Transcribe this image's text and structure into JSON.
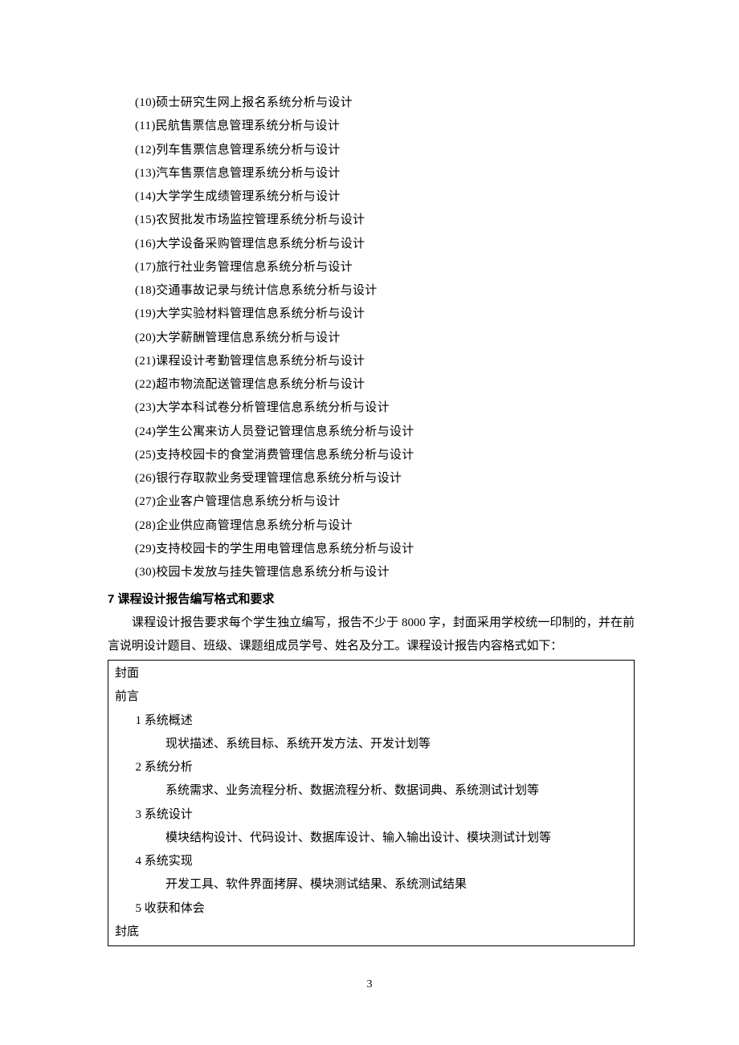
{
  "list": {
    "items": [
      "(10)硕士研究生网上报名系统分析与设计",
      "(11)民航售票信息管理系统分析与设计",
      "(12)列车售票信息管理系统分析与设计",
      "(13)汽车售票信息管理系统分析与设计",
      "(14)大学学生成绩管理系统分析与设计",
      "(15)农贸批发市场监控管理系统分析与设计",
      "(16)大学设备采购管理信息系统分析与设计",
      "(17)旅行社业务管理信息系统分析与设计",
      "(18)交通事故记录与统计信息系统分析与设计",
      "(19)大学实验材料管理信息系统分析与设计",
      "(20)大学薪酬管理信息系统分析与设计",
      "(21)课程设计考勤管理信息系统分析与设计",
      "(22)超市物流配送管理信息系统分析与设计",
      "(23)大学本科试卷分析管理信息系统分析与设计",
      "(24)学生公寓来访人员登记管理信息系统分析与设计",
      "(25)支持校园卡的食堂消费管理信息系统分析与设计",
      "(26)银行存取款业务受理管理信息系统分析与设计",
      "(27)企业客户管理信息系统分析与设计",
      "(28)企业供应商管理信息系统分析与设计",
      "(29)支持校园卡的学生用电管理信息系统分析与设计",
      "(30)校园卡发放与挂失管理信息系统分析与设计"
    ]
  },
  "heading": "7 课程设计报告编写格式和要求",
  "paragraph": "课程设计报告要求每个学生独立编写，报告不少于 8000 字，封面采用学校统一印制的，并在前言说明设计题目、班级、课题组成员学号、姓名及分工。课程设计报告内容格式如下：",
  "box": {
    "lines": [
      {
        "lvl": "lvl0",
        "text": "封面"
      },
      {
        "lvl": "lvl0",
        "text": "前言"
      },
      {
        "lvl": "lvl1",
        "text": "1  系统概述"
      },
      {
        "lvl": "lvl2",
        "text": "现状描述、系统目标、系统开发方法、开发计划等"
      },
      {
        "lvl": "lvl1",
        "text": "2  系统分析"
      },
      {
        "lvl": "lvl2",
        "text": "系统需求、业务流程分析、数据流程分析、数据词典、系统测试计划等"
      },
      {
        "lvl": "lvl1",
        "text": "3  系统设计"
      },
      {
        "lvl": "lvl2",
        "text": "模块结构设计、代码设计、数据库设计、输入输出设计、模块测试计划等"
      },
      {
        "lvl": "lvl1",
        "text": "4  系统实现"
      },
      {
        "lvl": "lvl2",
        "text": "开发工具、软件界面拷屏、模块测试结果、系统测试结果"
      },
      {
        "lvl": "lvl1",
        "text": "5  收获和体会"
      },
      {
        "lvl": "lvl0",
        "text": "封底"
      }
    ]
  },
  "pageNumber": "3"
}
